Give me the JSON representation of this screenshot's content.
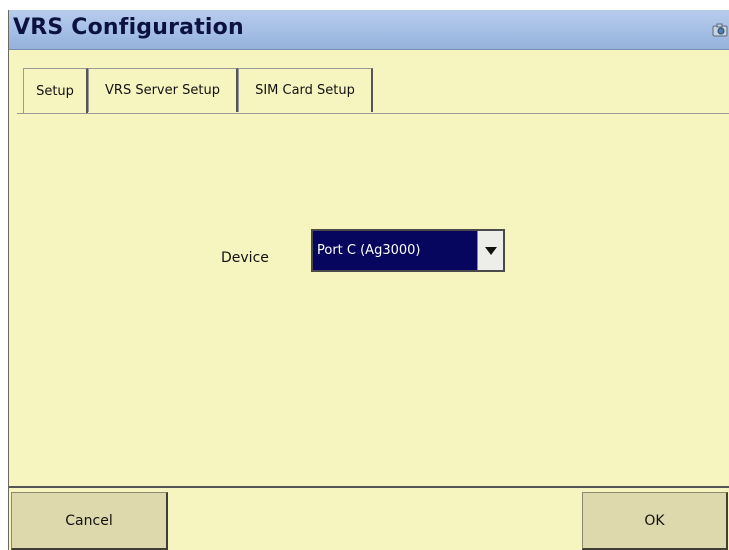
{
  "window": {
    "title": "VRS Configuration"
  },
  "tabs": [
    {
      "label": "Setup",
      "active": true
    },
    {
      "label": "VRS Server Setup",
      "active": false
    },
    {
      "label": "SIM Card Setup",
      "active": false
    }
  ],
  "device": {
    "label": "Device",
    "selected": "Port C (Ag3000)"
  },
  "buttons": {
    "cancel": "Cancel",
    "ok": "OK"
  },
  "icons": {
    "title_action": "camera-icon",
    "dropdown": "dropdown-triangle-icon"
  },
  "colors": {
    "background": "#f7f5bf",
    "titlebar": "#a9c1e8",
    "selection": "#07065f",
    "button": "#ddd9ad"
  }
}
